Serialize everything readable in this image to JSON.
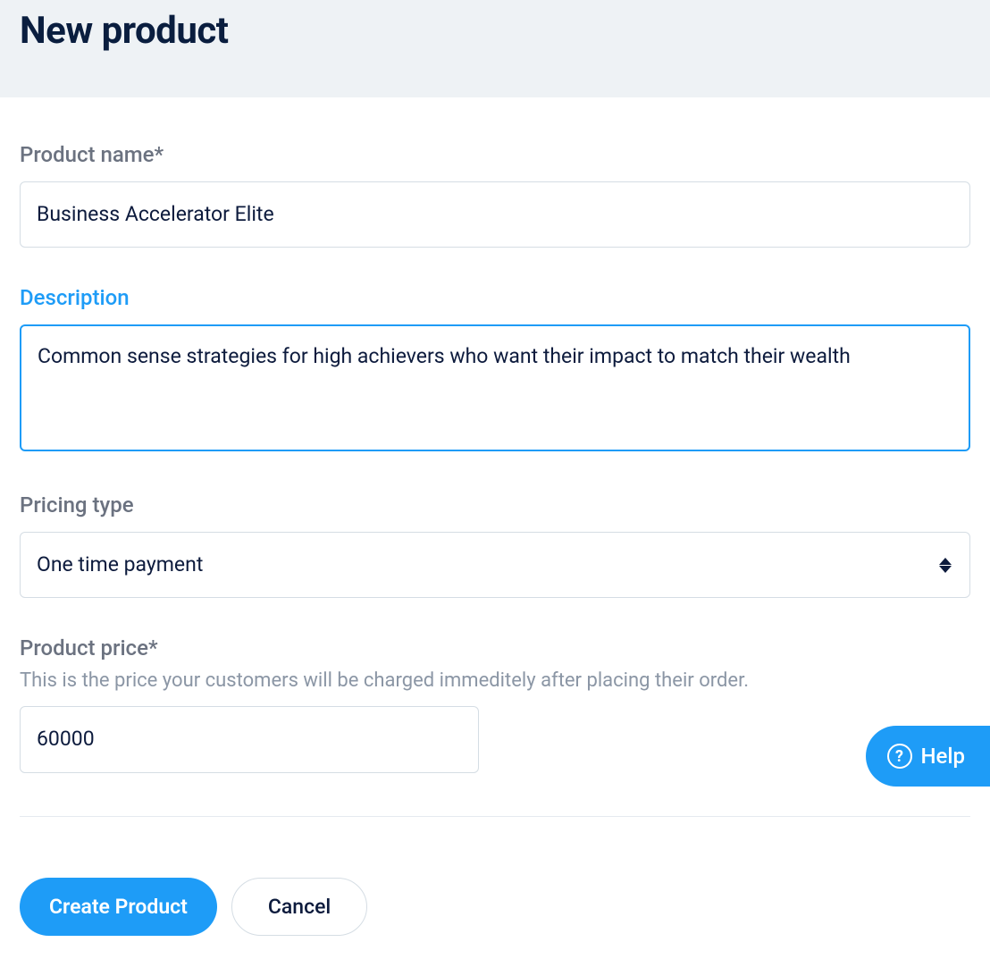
{
  "header": {
    "title": "New product"
  },
  "form": {
    "product_name": {
      "label": "Product name*",
      "value": "Business Accelerator Elite"
    },
    "description": {
      "label": "Description",
      "value": "Common sense strategies for high achievers who want their impact to match their wealth"
    },
    "pricing_type": {
      "label": "Pricing type",
      "value": "One time payment"
    },
    "product_price": {
      "label": "Product price*",
      "helper": "This is the price your customers will be charged immeditely after placing their order.",
      "value": "60000"
    }
  },
  "actions": {
    "create": "Create Product",
    "cancel": "Cancel"
  },
  "help": {
    "label": "Help"
  }
}
